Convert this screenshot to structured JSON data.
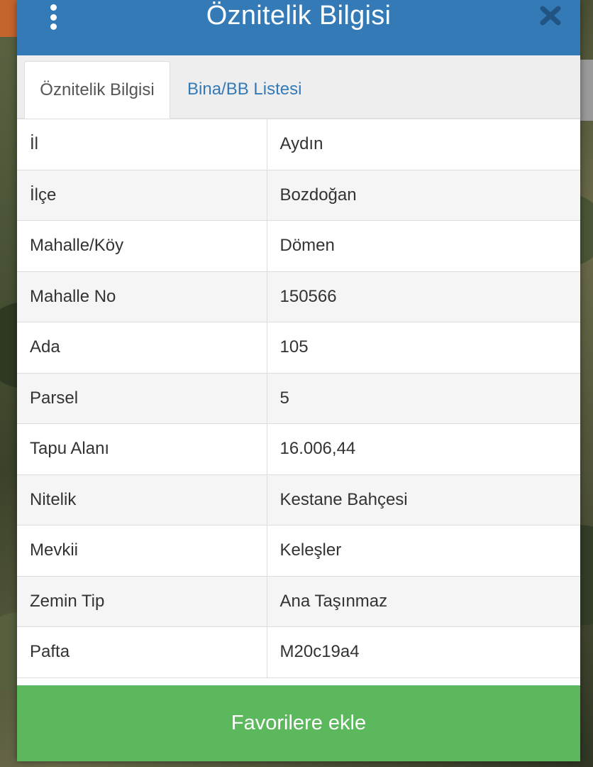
{
  "modal": {
    "title": "Öznitelik Bilgisi"
  },
  "tabs": [
    {
      "label": "Öznitelik Bilgisi",
      "active": true
    },
    {
      "label": "Bina/BB Listesi",
      "active": false
    }
  ],
  "attributes": [
    {
      "key": "İl",
      "value": "Aydın"
    },
    {
      "key": "İlçe",
      "value": "Bozdoğan"
    },
    {
      "key": "Mahalle/Köy",
      "value": "Dömen"
    },
    {
      "key": "Mahalle No",
      "value": "150566"
    },
    {
      "key": "Ada",
      "value": "105"
    },
    {
      "key": "Parsel",
      "value": "5"
    },
    {
      "key": "Tapu Alanı",
      "value": "16.006,44"
    },
    {
      "key": "Nitelik",
      "value": "Kestane Bahçesi"
    },
    {
      "key": "Mevkii",
      "value": "Keleşler"
    },
    {
      "key": "Zemin Tip",
      "value": "Ana Taşınmaz"
    },
    {
      "key": "Pafta",
      "value": "M20c19a4"
    }
  ],
  "footer": {
    "favorite_label": "Favorilere ekle"
  },
  "colors": {
    "header": "#337ab7",
    "tab_link": "#337ab7",
    "favorite_button": "#5cb85c",
    "close_icon": "#1f4e79"
  },
  "icons": {
    "menu": "vertical-dots-icon",
    "close": "close-icon"
  }
}
